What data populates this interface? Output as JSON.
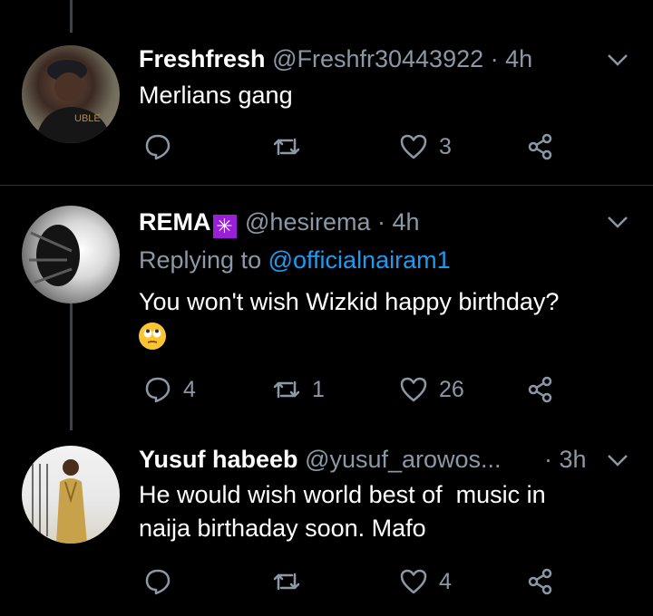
{
  "colors": {
    "background": "#000000",
    "muted": "#8b98a5",
    "link": "#1d9bf0",
    "badge": "#9a1fd9"
  },
  "tweets": [
    {
      "name": "Freshfresh",
      "handle": "@Freshfr30443922",
      "separator": "·",
      "time": "4h",
      "body_lines": [
        "Merlians gang"
      ],
      "actions": {
        "reply": "",
        "retweet": "",
        "like": "3"
      }
    },
    {
      "name": "REMA",
      "handle": "@hesirema",
      "separator": "·",
      "time": "4h",
      "replying_prefix": "Replying to",
      "replying_mention": "@officialnairam1",
      "body_lines": [
        "You won't wish Wizkid happy birthday?"
      ],
      "emoji": "eye-roll-emoji",
      "actions": {
        "reply": "4",
        "retweet": "1",
        "like": "26"
      }
    },
    {
      "name": "Yusuf habeeb",
      "handle": "@yusuf_arowos...",
      "separator": "·",
      "time": "3h",
      "body_lines": [
        "He would wish world best of  music in",
        "naija birthaday soon. Mafo"
      ],
      "actions": {
        "reply": "",
        "retweet": "",
        "like": "4"
      }
    }
  ]
}
